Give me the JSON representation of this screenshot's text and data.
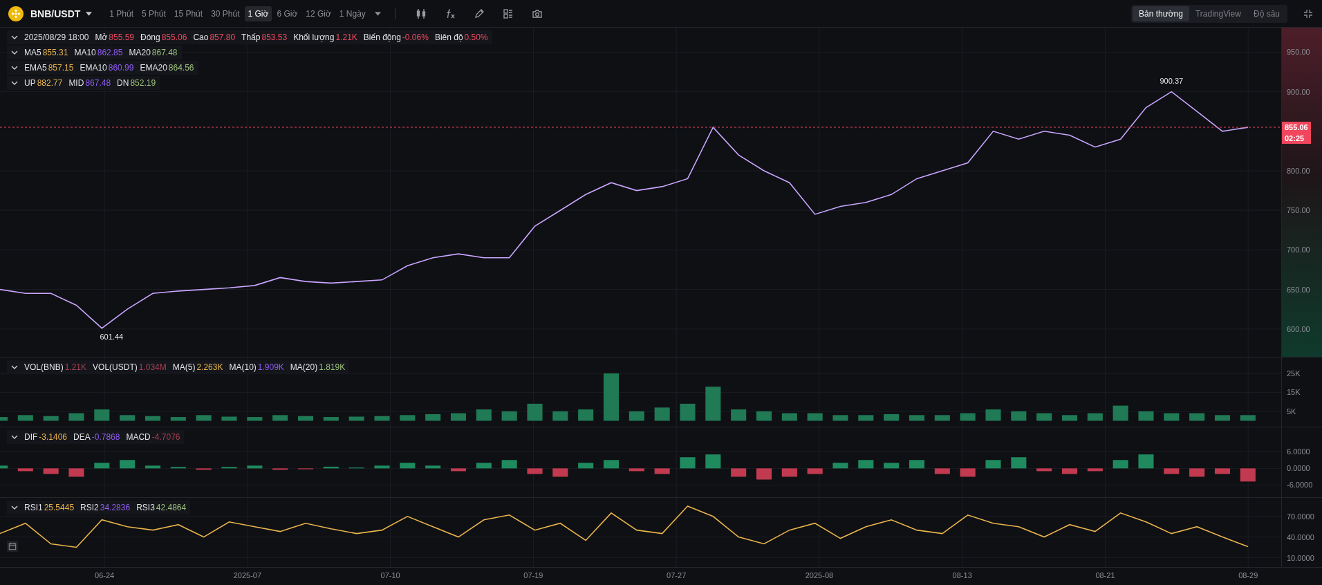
{
  "toolbar": {
    "symbol": "BNB/USDT",
    "intervals": [
      {
        "label": "1 Phút",
        "selected": false
      },
      {
        "label": "5 Phút",
        "selected": false
      },
      {
        "label": "15 Phút",
        "selected": false
      },
      {
        "label": "30 Phút",
        "selected": false
      },
      {
        "label": "1 Giờ",
        "selected": true
      },
      {
        "label": "6 Giờ",
        "selected": false
      },
      {
        "label": "12 Giờ",
        "selected": false
      },
      {
        "label": "1 Ngày",
        "selected": false
      }
    ],
    "views": [
      {
        "label": "Bản thường",
        "selected": true
      },
      {
        "label": "TradingView",
        "selected": false
      },
      {
        "label": "Độ sâu",
        "selected": false
      }
    ]
  },
  "main": {
    "ohlc": {
      "date": "2025/08/29 18:00",
      "fields": [
        {
          "label": "Mở",
          "value": "855.59"
        },
        {
          "label": "Đóng",
          "value": "855.06"
        },
        {
          "label": "Cao",
          "value": "857.80"
        },
        {
          "label": "Thấp",
          "value": "853.53"
        },
        {
          "label": "Khối lượng",
          "value": "1.21K"
        },
        {
          "label": "Biến động",
          "value": "-0.06%"
        },
        {
          "label": "Biên độ",
          "value": "0.50%"
        }
      ]
    },
    "legends": [
      [
        {
          "label": "MA5",
          "value": "855.31",
          "color": "#e9b44c"
        },
        {
          "label": "MA10",
          "value": "862.85",
          "color": "#8f5cf0"
        },
        {
          "label": "MA20",
          "value": "867.48",
          "color": "#9cc07a"
        }
      ],
      [
        {
          "label": "EMA5",
          "value": "857.15",
          "color": "#e9b44c"
        },
        {
          "label": "EMA10",
          "value": "860.99",
          "color": "#8f5cf0"
        },
        {
          "label": "EMA20",
          "value": "864.56",
          "color": "#9cc07a"
        }
      ],
      [
        {
          "label": "UP",
          "value": "882.77",
          "color": "#e9b44c"
        },
        {
          "label": "MID",
          "value": "867.48",
          "color": "#8f5cf0"
        },
        {
          "label": "DN",
          "value": "852.19",
          "color": "#9cc07a"
        }
      ]
    ],
    "last_price": {
      "countdown": "02:25"
    },
    "extremes": [
      {
        "kind": "high",
        "text": "900.37"
      },
      {
        "kind": "low",
        "text": "601.44"
      }
    ],
    "x_axis": [
      "06-24",
      "2025-07",
      "07-10",
      "07-19",
      "07-27",
      "2025-08",
      "08-13",
      "08-21",
      "08-29"
    ],
    "chart_data": {
      "type": "line",
      "ylim": [
        565,
        981
      ],
      "grid": true,
      "ref_lines": [
        {
          "axis": "y",
          "value": 855.06,
          "label": "855.06",
          "color": "#e8425c"
        }
      ],
      "yticks": [
        {
          "value": 950,
          "label": "950.00"
        },
        {
          "value": 900,
          "label": "900.00"
        },
        {
          "value": 800,
          "label": "800.00"
        },
        {
          "value": 750,
          "label": "750.00"
        },
        {
          "value": 700,
          "label": "700.00"
        },
        {
          "value": 650,
          "label": "650.00"
        },
        {
          "value": 600,
          "label": "600.00"
        }
      ],
      "series": [
        {
          "color": "#c9a6ff",
          "values": [
            650,
            645,
            645,
            630,
            601,
            625,
            645,
            648,
            650,
            652,
            655,
            665,
            660,
            658,
            660,
            662,
            680,
            690,
            695,
            690,
            690,
            730,
            750,
            770,
            785,
            775,
            780,
            790,
            855,
            820,
            800,
            785,
            745,
            755,
            760,
            770,
            790,
            800,
            810,
            850,
            840,
            850,
            845,
            830,
            840,
            880,
            900,
            875,
            850,
            855
          ]
        }
      ]
    }
  },
  "volume": {
    "legends": [
      [
        {
          "label": "VOL(BNB)",
          "value": "1.21K",
          "color": "#a8404f"
        },
        {
          "label": "VOL(USDT)",
          "value": "1.034M",
          "color": "#a8404f"
        },
        {
          "label": "MA(5)",
          "value": "2.263K",
          "color": "#e9b44c"
        },
        {
          "label": "MA(10)",
          "value": "1.909K",
          "color": "#8f5cf0"
        },
        {
          "label": "MA(20)",
          "value": "1.819K",
          "color": "#9cc07a"
        }
      ]
    ],
    "chart_data": {
      "type": "bar",
      "ylim": [
        -3,
        33.4
      ],
      "grid": true,
      "yticks": [
        {
          "value": 25,
          "label": "25K"
        },
        {
          "value": 15,
          "label": "15K"
        },
        {
          "value": 5,
          "label": "5K"
        }
      ],
      "series": [
        {
          "color": "#1f7a55",
          "values": [
            2,
            3,
            2.5,
            4,
            6,
            3,
            2.5,
            2,
            3,
            2.2,
            2,
            3,
            2.5,
            2,
            2.2,
            2.5,
            3,
            3.5,
            4,
            6,
            5,
            9,
            5,
            6,
            25,
            5,
            7,
            9,
            18,
            6,
            5,
            4,
            4,
            3,
            3,
            3.5,
            3,
            3,
            4,
            6,
            5,
            4,
            3,
            4,
            8,
            5,
            4,
            4,
            3,
            3
          ]
        }
      ]
    }
  },
  "macd": {
    "legends": [
      [
        {
          "label": "DIF",
          "value": "-3.1406",
          "color": "#e9b44c"
        },
        {
          "label": "DEA",
          "value": "-0.7868",
          "color": "#8f5cf0"
        },
        {
          "label": "MACD",
          "value": "-4.7076",
          "color": "#a8404f"
        }
      ]
    ],
    "chart_data": {
      "type": "bar",
      "ylim": [
        -10.5,
        14.7
      ],
      "grid": true,
      "yticks": [
        {
          "value": 6,
          "label": "6.0000"
        },
        {
          "value": 0,
          "label": "0.0000"
        },
        {
          "value": -6,
          "label": "-6.0000"
        }
      ],
      "series": [
        {
          "color": "#1f8a5e",
          "values": [
            1,
            null,
            null,
            null,
            2,
            3,
            1,
            0.5,
            null,
            0.5,
            1,
            null,
            null,
            0.6,
            0.3,
            1,
            2,
            1,
            null,
            2,
            3,
            null,
            null,
            2,
            3,
            null,
            null,
            4,
            5,
            null,
            null,
            null,
            null,
            2,
            3,
            2,
            3,
            null,
            null,
            3,
            4,
            null,
            null,
            null,
            3,
            5,
            null,
            null,
            null,
            null
          ]
        },
        {
          "color": "#c23a50",
          "values": [
            null,
            -1,
            -2,
            -3,
            null,
            null,
            null,
            null,
            -0.5,
            null,
            null,
            -0.5,
            -0.3,
            null,
            null,
            null,
            null,
            null,
            -1,
            null,
            null,
            -2,
            -3,
            null,
            null,
            -1,
            -2,
            null,
            null,
            -3,
            -4,
            -3,
            -2,
            null,
            null,
            null,
            null,
            -2,
            -3,
            null,
            null,
            -1,
            -2,
            -1,
            null,
            null,
            -2,
            -3,
            -2,
            -4.7
          ]
        }
      ]
    }
  },
  "rsi": {
    "legends": [
      [
        {
          "label": "RSI1",
          "value": "25.5445",
          "color": "#e9b44c"
        },
        {
          "label": "RSI2",
          "value": "34.2836",
          "color": "#8f5cf0"
        },
        {
          "label": "RSI3",
          "value": "42.4864",
          "color": "#9cc07a"
        }
      ]
    ],
    "chart_data": {
      "type": "line",
      "ylim": [
        -3.5,
        97
      ],
      "grid": true,
      "yticks": [
        {
          "value": 70,
          "label": "70.0000"
        },
        {
          "value": 40,
          "label": "40.0000"
        },
        {
          "value": 10,
          "label": "10.0000"
        }
      ],
      "series": [
        {
          "color": "#e9b44c",
          "values": [
            45,
            60,
            30,
            25,
            65,
            55,
            50,
            58,
            40,
            62,
            55,
            48,
            60,
            52,
            45,
            50,
            70,
            55,
            40,
            65,
            72,
            50,
            60,
            35,
            75,
            50,
            45,
            85,
            70,
            40,
            30,
            50,
            60,
            38,
            55,
            65,
            50,
            45,
            72,
            60,
            55,
            40,
            58,
            48,
            75,
            62,
            45,
            55,
            40,
            26
          ]
        }
      ]
    }
  }
}
